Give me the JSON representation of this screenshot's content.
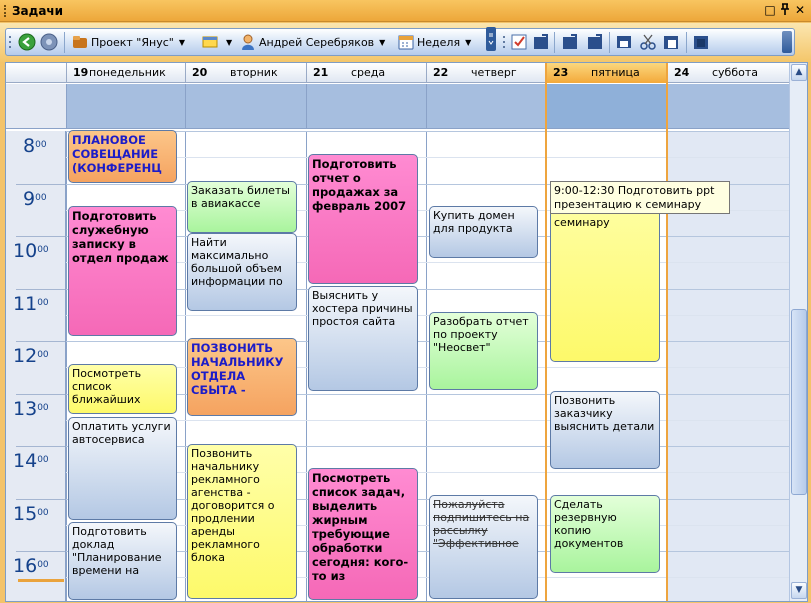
{
  "window": {
    "title": "Задачи",
    "controls": [
      "□",
      "ᵖ",
      "✕"
    ]
  },
  "toolbar": {
    "project_label": "Проект \"Янус\"",
    "user_label": "Андрей Серебряков",
    "view_label": "Неделя"
  },
  "days": [
    {
      "num": "19",
      "name": "понедельник"
    },
    {
      "num": "20",
      "name": "вторник"
    },
    {
      "num": "21",
      "name": "среда"
    },
    {
      "num": "22",
      "name": "четверг"
    },
    {
      "num": "23",
      "name": "пятница"
    },
    {
      "num": "24",
      "name": "суббота"
    }
  ],
  "times": [
    "8",
    "9",
    "10",
    "11",
    "12",
    "13",
    "14",
    "15",
    "16"
  ],
  "time_suffix": "00",
  "appointments": {
    "mon_1": "ПЛАНОВОЕ СОВЕЩАНИЕ (КОНФЕРЕНЦ",
    "mon_2": "Подготовить служебную записку в отдел продаж",
    "mon_3": "Посмотреть список ближайших",
    "mon_4": "Оплатить услуги автосервиса",
    "mon_5": "Подготовить доклад \"Планирование времени на",
    "tue_1": "Заказать билеты в авиакассе",
    "tue_2": "Найти максимально большой объем информации по",
    "tue_3": "ПОЗВОНИТЬ НАЧАЛЬНИКУ ОТДЕЛА СБЫТА -",
    "tue_4": "Позвонить начальнику рекламного агенства - договорится о продлении аренды рекламного блока",
    "wed_1": "Подготовить отчет о продажах за февраль 2007",
    "wed_2": "Выяснить у хостера причины простоя сайта",
    "wed_3": "Посмотреть список задач, выделить жирным требующие обработки сегодня: кого-то из",
    "thu_1": "Купить домен для продукта",
    "thu_2": "Разобрать отчет по проекту \"Неосвет\"",
    "thu_3": "Пожалуйста подпишитесь на рассылку \"Эффективное",
    "fri_1": "семинару",
    "fri_2": "Позвонить заказчику выяснить детали",
    "fri_3": "Сделать резервную копию документов"
  },
  "tooltip": "9:00-12:30 Подготовить ppt презентацию к семинару",
  "icons": [
    "grip-icon",
    "back-icon",
    "forward-icon",
    "project-icon",
    "category-icon",
    "user-icon",
    "calendar-icon",
    "task-icon",
    "cut-icon",
    "paste-icon"
  ]
}
